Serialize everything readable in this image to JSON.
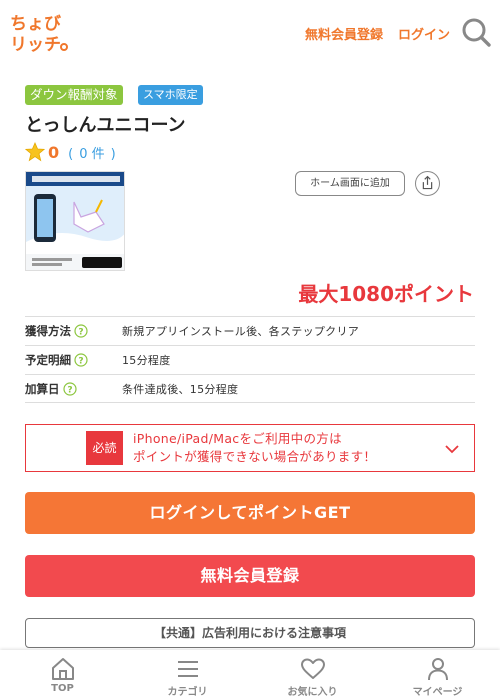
{
  "header": {
    "logo_text": "ちょびリッチ。",
    "register_label": "無料会員登録",
    "login_label": "ログイン"
  },
  "badges": {
    "download": "ダウン報酬対象",
    "smartphone": "スマホ限定"
  },
  "app": {
    "title": "とっしんユニコーン",
    "rating": "0",
    "review_count": "0 件",
    "paren_open": "(",
    "paren_close": ")",
    "home_add_label": "ホーム画面に追加",
    "max_points": "最大1080ポイント"
  },
  "info": [
    {
      "label": "獲得方法",
      "value": "新規アプリインストール後、各ステップクリア"
    },
    {
      "label": "予定明細",
      "value": "15分程度"
    },
    {
      "label": "加算日",
      "value": "条件達成後、15分程度"
    }
  ],
  "notice": {
    "tag": "必読",
    "line1": "iPhone/iPad/Macをご利用中の方は",
    "line2": "ポイントが獲得できない場合があります！"
  },
  "cta": {
    "login": "ログインしてポイントGET",
    "register": "無料会員登録"
  },
  "caution_label": "【共通】広告利用における注意事項",
  "nav": [
    {
      "label": "TOP",
      "icon": "home-icon"
    },
    {
      "label": "カテゴリ",
      "icon": "menu-icon"
    },
    {
      "label": "お気に入り",
      "icon": "heart-icon"
    },
    {
      "label": "マイページ",
      "icon": "user-icon"
    }
  ],
  "colors": {
    "brand_orange": "#f0772c",
    "login_button": "#f57636",
    "register_button": "#f24a4e",
    "notice_red": "#e8383d",
    "badge_green": "#8cc63f",
    "badge_blue": "#3a9ee0"
  }
}
